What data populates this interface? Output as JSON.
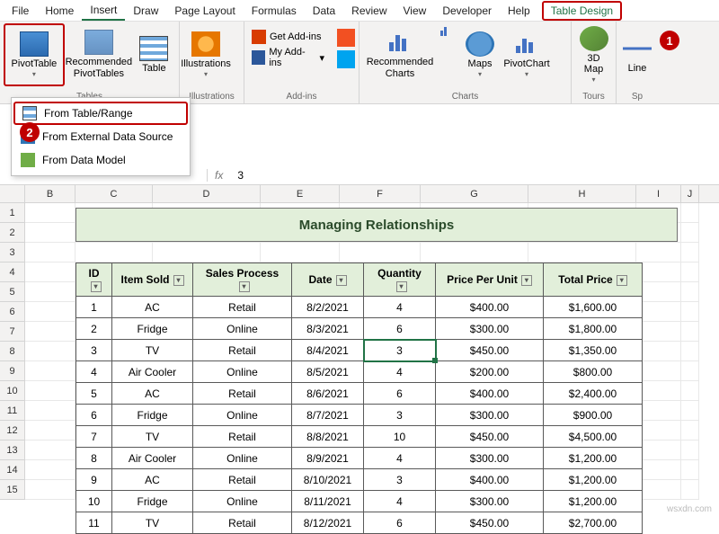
{
  "menu": [
    "File",
    "Home",
    "Insert",
    "Draw",
    "Page Layout",
    "Formulas",
    "Data",
    "Review",
    "View",
    "Developer",
    "Help",
    "Table Design"
  ],
  "active_menu": "Insert",
  "ribbon": {
    "tables": {
      "label": "Tables",
      "pivottable": "PivotTable",
      "recommended": "Recommended PivotTables",
      "table": "Table"
    },
    "illustrations": {
      "label": "Illustrations",
      "btn": "Illustrations"
    },
    "addins": {
      "label": "Add-ins",
      "get": "Get Add-ins",
      "my": "My Add-ins",
      "bing": ""
    },
    "charts": {
      "label": "Charts",
      "rec": "Recommended Charts",
      "maps": "Maps",
      "pivotchart": "PivotChart"
    },
    "tours": {
      "label": "Tours",
      "map3d": "3D Map"
    },
    "sparklines": {
      "line": "Line",
      "label": "Sp"
    }
  },
  "pivot_menu": {
    "from_table": "From Table/Range",
    "from_external": "From External Data Source",
    "from_model": "From Data Model"
  },
  "formula_bar": {
    "fx": "fx",
    "value": "3"
  },
  "columns": [
    "B",
    "C",
    "D",
    "E",
    "F",
    "G",
    "H",
    "I",
    "J"
  ],
  "row_numbers": [
    1,
    2,
    3,
    4,
    5,
    6,
    7,
    8,
    9,
    10,
    11,
    12,
    13,
    14,
    15
  ],
  "title": "Managing Relationships",
  "headers": [
    "ID",
    "Item Sold",
    "Sales Process",
    "Date",
    "Quantity",
    "Price Per Unit",
    "Total Price"
  ],
  "rows": [
    {
      "id": "1",
      "item": "AC",
      "proc": "Retail",
      "date": "8/2/2021",
      "qty": "4",
      "ppu": "$400.00",
      "tot": "$1,600.00"
    },
    {
      "id": "2",
      "item": "Fridge",
      "proc": "Online",
      "date": "8/3/2021",
      "qty": "6",
      "ppu": "$300.00",
      "tot": "$1,800.00"
    },
    {
      "id": "3",
      "item": "TV",
      "proc": "Retail",
      "date": "8/4/2021",
      "qty": "3",
      "ppu": "$450.00",
      "tot": "$1,350.00"
    },
    {
      "id": "4",
      "item": "Air Cooler",
      "proc": "Online",
      "date": "8/5/2021",
      "qty": "4",
      "ppu": "$200.00",
      "tot": "$800.00"
    },
    {
      "id": "5",
      "item": "AC",
      "proc": "Retail",
      "date": "8/6/2021",
      "qty": "6",
      "ppu": "$400.00",
      "tot": "$2,400.00"
    },
    {
      "id": "6",
      "item": "Fridge",
      "proc": "Online",
      "date": "8/7/2021",
      "qty": "3",
      "ppu": "$300.00",
      "tot": "$900.00"
    },
    {
      "id": "7",
      "item": "TV",
      "proc": "Retail",
      "date": "8/8/2021",
      "qty": "10",
      "ppu": "$450.00",
      "tot": "$4,500.00"
    },
    {
      "id": "8",
      "item": "Air Cooler",
      "proc": "Online",
      "date": "8/9/2021",
      "qty": "4",
      "ppu": "$300.00",
      "tot": "$1,200.00"
    },
    {
      "id": "9",
      "item": "AC",
      "proc": "Retail",
      "date": "8/10/2021",
      "qty": "3",
      "ppu": "$400.00",
      "tot": "$1,200.00"
    },
    {
      "id": "10",
      "item": "Fridge",
      "proc": "Online",
      "date": "8/11/2021",
      "qty": "4",
      "ppu": "$300.00",
      "tot": "$1,200.00"
    },
    {
      "id": "11",
      "item": "TV",
      "proc": "Retail",
      "date": "8/12/2021",
      "qty": "6",
      "ppu": "$450.00",
      "tot": "$2,700.00"
    }
  ],
  "active_cell_row": 2,
  "badges": {
    "one": "1",
    "two": "2"
  },
  "watermark": "wsxdn.com"
}
